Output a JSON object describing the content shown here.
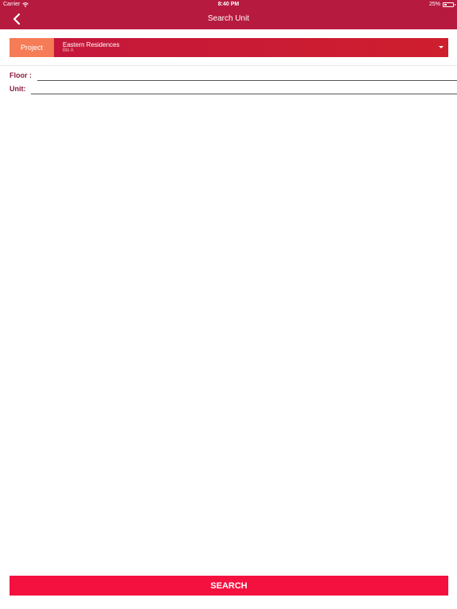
{
  "status_bar": {
    "carrier": "Carrier",
    "time": "8:40 PM",
    "battery_percent": "25%",
    "battery_level": 0.25,
    "wifi_icon": "wifi-icon",
    "battery_icon": "battery-icon"
  },
  "nav": {
    "title": "Search Unit",
    "back_icon": "chevron-left-icon"
  },
  "project": {
    "label": "Project",
    "selected_name": "Eastern Residences",
    "selected_block": "Blk A",
    "dropdown_icon": "caret-down-icon"
  },
  "form": {
    "floor_label": "Floor :",
    "floor_value": "",
    "unit_label": "Unit:",
    "unit_value": ""
  },
  "actions": {
    "search_label": "SEARCH"
  },
  "colors": {
    "header": "#b71a3f",
    "project_label_bg": "#f57c56",
    "project_select_bg": "#c5173b",
    "search_button": "#f4113f",
    "label_text": "#8a1a3a"
  }
}
